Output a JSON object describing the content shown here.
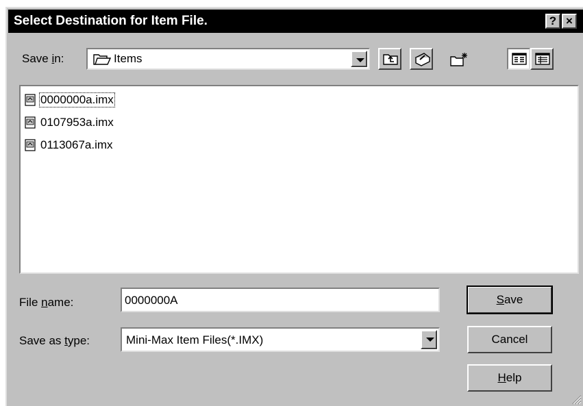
{
  "dialog": {
    "title": "Select Destination for Item File.",
    "help_glyph": "?",
    "close_glyph": "×"
  },
  "save_in": {
    "prefix": "Save ",
    "accel": "i",
    "suffix": "n:",
    "value": "Items",
    "icon": "folder-icon"
  },
  "toolbar": {
    "buttons": [
      "up-one-level-icon",
      "desktop-icon",
      "new-folder-icon",
      "list-view-icon",
      "details-view-icon"
    ]
  },
  "files": [
    {
      "name": "0000000a.imx",
      "icon": "document-icon",
      "focused": true
    },
    {
      "name": "0107953a.imx",
      "icon": "document-icon",
      "focused": false
    },
    {
      "name": "0113067a.imx",
      "icon": "document-icon",
      "focused": false
    }
  ],
  "file_name": {
    "prefix": "File ",
    "accel": "n",
    "suffix": "ame:",
    "value": "0000000A"
  },
  "save_as_type": {
    "prefix": "Save as ",
    "accel": "t",
    "suffix": "ype:",
    "value": "Mini-Max Item Files(*.IMX)"
  },
  "buttons": {
    "save": {
      "accel": "S",
      "rest": "ave"
    },
    "cancel": {
      "label": "Cancel"
    },
    "help": {
      "accel": "H",
      "rest": "elp"
    }
  },
  "colors": {
    "face": "#c0c0c0",
    "titlebar": "#000000",
    "highlight": "#ffffff",
    "shadow": "#808080"
  }
}
